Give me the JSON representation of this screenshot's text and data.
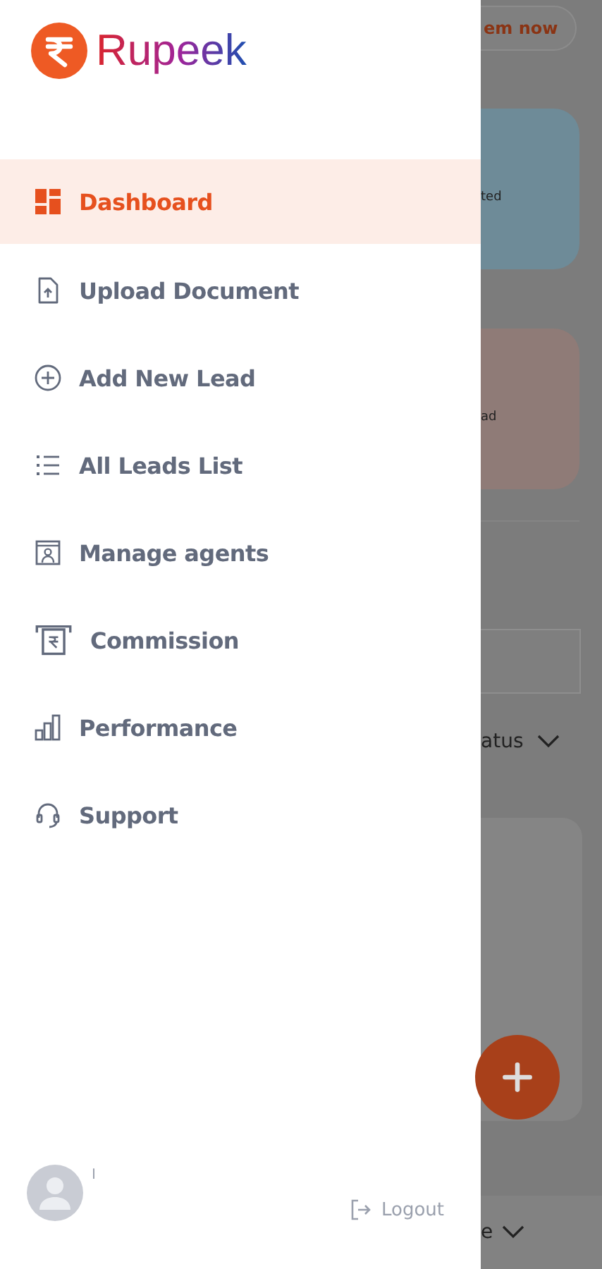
{
  "brand": {
    "name": "Rupeek"
  },
  "menu": [
    {
      "label": "Dashboard",
      "selected": true,
      "kind": "dashboard"
    },
    {
      "label": "Upload Document",
      "selected": false,
      "kind": "upload"
    },
    {
      "label": "Add New Lead",
      "selected": false,
      "kind": "add"
    },
    {
      "label": "All Leads List",
      "selected": false,
      "kind": "list"
    },
    {
      "label": "Manage agents",
      "selected": false,
      "kind": "agents"
    },
    {
      "label": "Commission",
      "selected": false,
      "kind": "commission"
    },
    {
      "label": "Performance",
      "selected": false,
      "kind": "performance"
    },
    {
      "label": "Support",
      "selected": false,
      "kind": "support"
    }
  ],
  "user": {
    "name": "I"
  },
  "logout": {
    "label": "Logout"
  },
  "background": {
    "top_button": "em now",
    "card_texts": [
      "ted",
      "ad"
    ],
    "filter": "atus",
    "bottom": "e"
  }
}
